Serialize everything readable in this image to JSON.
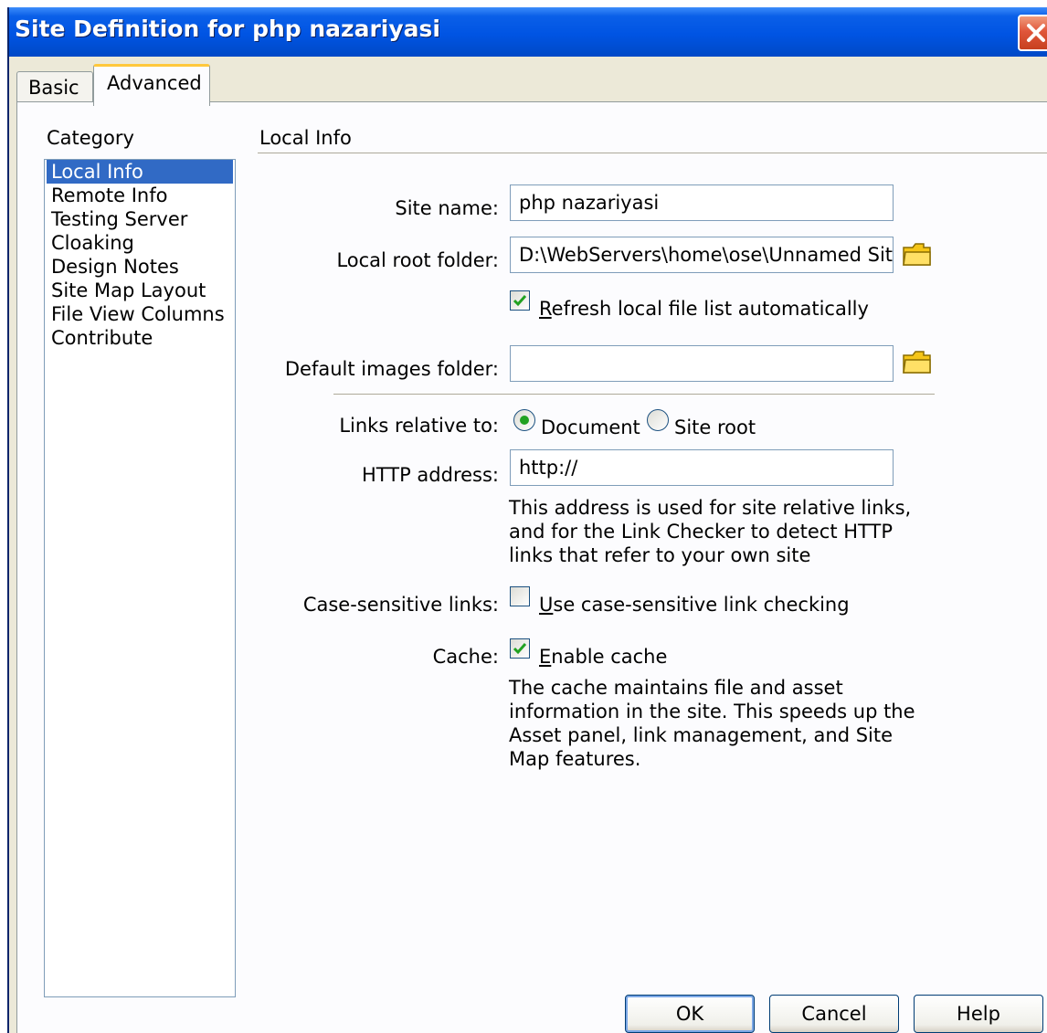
{
  "window": {
    "title": "Site Definition for php nazariyasi"
  },
  "tabs": [
    {
      "label": "Basic",
      "selected": false
    },
    {
      "label": "Advanced",
      "selected": true
    }
  ],
  "category": {
    "heading": "Category",
    "items": [
      {
        "label": "Local Info",
        "selected": true
      },
      {
        "label": "Remote Info",
        "selected": false
      },
      {
        "label": "Testing Server",
        "selected": false
      },
      {
        "label": "Cloaking",
        "selected": false
      },
      {
        "label": "Design Notes",
        "selected": false
      },
      {
        "label": "Site Map Layout",
        "selected": false
      },
      {
        "label": "File View Columns",
        "selected": false
      },
      {
        "label": "Contribute",
        "selected": false
      }
    ]
  },
  "local_info": {
    "heading": "Local Info",
    "site_name": {
      "label": "Site name:",
      "value": "php nazariyasi"
    },
    "local_root": {
      "label": "Local root folder:",
      "value": "D:\\WebServers\\home\\ose\\Unnamed Site"
    },
    "refresh": {
      "mnemonic": "R",
      "rest": "efresh local file list automatically",
      "checked": true
    },
    "images_folder": {
      "label": "Default images folder:",
      "value": ""
    },
    "links_relative": {
      "label": "Links relative to:",
      "options": [
        {
          "label": "Document",
          "selected": true
        },
        {
          "label": "Site root",
          "selected": false
        }
      ]
    },
    "http_address": {
      "label": "HTTP address:",
      "value": "http://",
      "help": "This address is used for site relative links,\nand for the Link Checker to detect HTTP\nlinks that refer to your own site"
    },
    "case_sensitive": {
      "label": "Case-sensitive links:",
      "mnemonic": "U",
      "rest": "se case-sensitive link checking",
      "checked": false
    },
    "cache": {
      "label": "Cache:",
      "mnemonic": "E",
      "rest": "nable cache",
      "checked": true,
      "help": "The cache maintains file and asset\ninformation in the site.  This speeds up the\nAsset panel, link management, and Site\nMap features."
    }
  },
  "buttons": {
    "ok": "OK",
    "cancel": "Cancel",
    "help": "Help"
  },
  "icons": {
    "folder": "folder-icon",
    "close": "close-icon"
  },
  "colors": {
    "titlebar": "#0054e3",
    "selection": "#316ac5",
    "check": "#21a121",
    "folder": "#f5c518"
  }
}
